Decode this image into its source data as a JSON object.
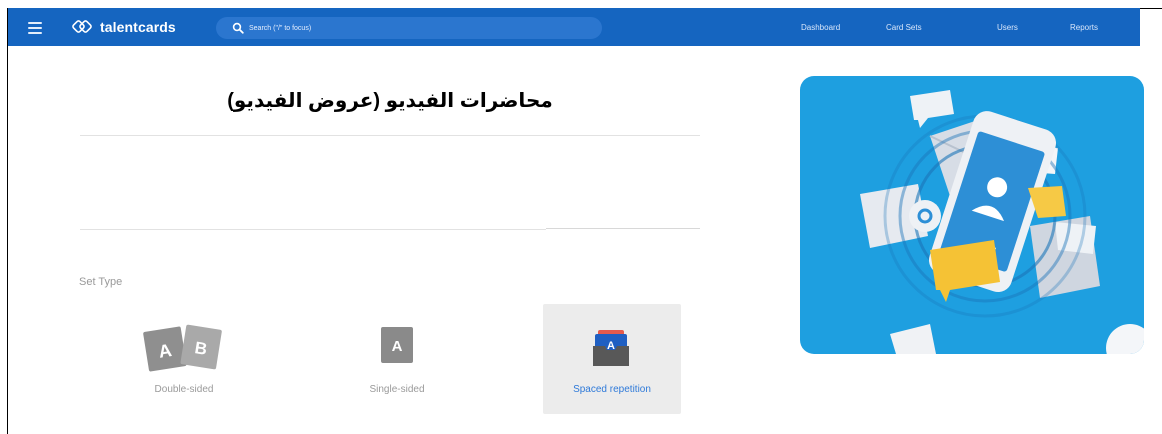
{
  "app": {
    "brand": "talentcards"
  },
  "search": {
    "placeholder": "Search (\"/\" to focus)"
  },
  "nav": {
    "items": [
      "Dashboard",
      "Card Sets",
      "Users",
      "Reports"
    ]
  },
  "set": {
    "title": "محاضرات الفيديو (عروض الفيديو)"
  },
  "set_type": {
    "label": "Set Type",
    "options": [
      {
        "label": "Double-sided",
        "icon": "double-sided-icon",
        "letters": [
          "A",
          "B"
        ]
      },
      {
        "label": "Single-sided",
        "icon": "single-sided-icon",
        "letters": [
          "A"
        ]
      },
      {
        "label": "Spaced repetition",
        "icon": "spaced-repetition-icon",
        "letters": [
          "A"
        ],
        "selected": true
      }
    ]
  },
  "colors": {
    "topbar": "#1565c0",
    "search_bg": "#2b76cf",
    "selected_text": "#2f7ad9",
    "hero_bg": "#1e9fe0"
  }
}
